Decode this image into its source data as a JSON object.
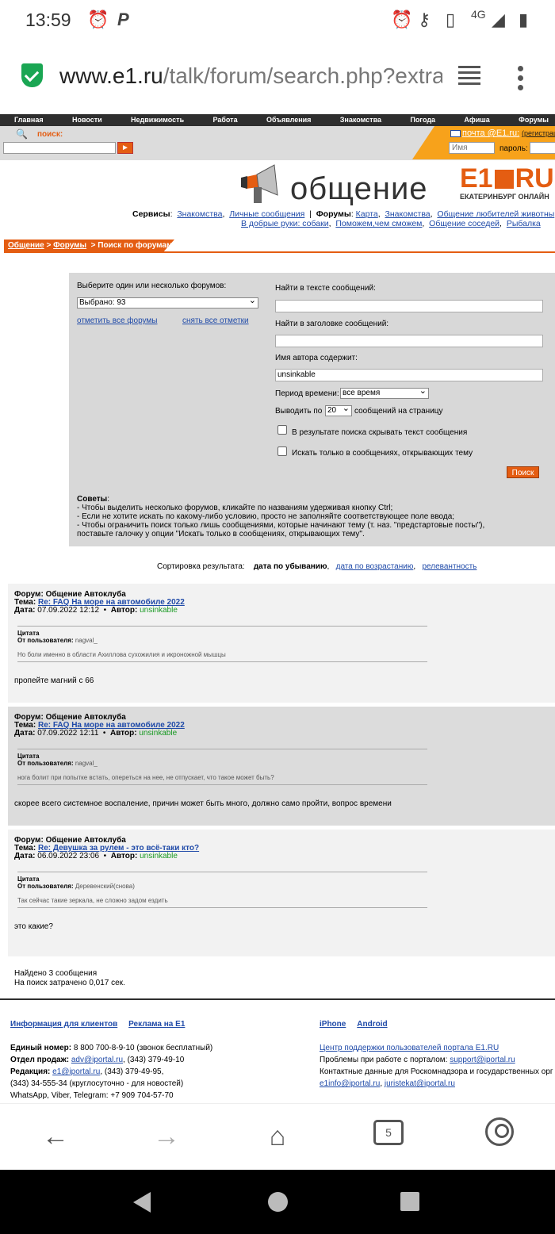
{
  "status": {
    "time": "13:59",
    "icons": [
      "alarm-icon",
      "p-icon"
    ],
    "right_icons": [
      "alarm-icon",
      "key-icon",
      "vibrate-icon",
      "4g-icon",
      "signal-icon",
      "battery-icon"
    ],
    "network": "4G"
  },
  "browser": {
    "url_host": "www.e1.ru",
    "url_path": "/talk/forum/search.php?extra",
    "tabs_count": "5"
  },
  "topnav": [
    "Главная",
    "Новости",
    "Недвижимость",
    "Работа",
    "Объявления",
    "Знакомства",
    "Погода",
    "Афиша",
    "Форумы"
  ],
  "search": {
    "label": "поиск:",
    "go": "►"
  },
  "mail": {
    "link": "почта @E1.ru:",
    "register": "(регистрац",
    "name_placeholder": "Имя",
    "password_label": "пароль:"
  },
  "logo": {
    "word": "общение",
    "brand": "E1",
    "brand_suffix": "RU",
    "city": "ЕКАТЕРИНБУРГ ОНЛАЙН"
  },
  "services": {
    "label": "Сервисы",
    "items": [
      "Знакомства",
      "Личные сообщения"
    ],
    "forums_label": "Форумы",
    "forums": [
      "Карта",
      "Знакомства",
      "Общение любителей животны"
    ],
    "forums2": [
      "В добрые руки: собаки",
      "Поможем,чем сможем",
      "Общение соседей",
      "Рыбалка"
    ]
  },
  "breadcrumb": {
    "a": "Общение",
    "b": "Форумы",
    "current": "Поиск по форумам",
    "sep": ">"
  },
  "form": {
    "choose_label": "Выберите один или несколько форумов:",
    "selected": "Выбрано: 93",
    "mark_all": "отметить все форумы",
    "unmark_all": "снять все отметки",
    "text_label": "Найти в тексте сообщений:",
    "title_label": "Найти в заголовке сообщений:",
    "author_label": "Имя автора содержит:",
    "author_value": "unsinkable",
    "period_label": "Период времени:",
    "period_value": "все время",
    "per_page_pre": "Выводить по",
    "per_page_value": "20",
    "per_page_post": "сообщений на страницу",
    "hide_text": "В результате поиска скрывать текст сообщения",
    "only_first": "Искать только в сообщениях, открывающих тему",
    "submit": "Поиск"
  },
  "tips": {
    "title": "Советы",
    "lines": [
      "- Чтобы выделить несколько форумов, кликайте по названиям удерживая кнопку Ctrl;",
      "- Если не хотите искать по какому-либо условию, просто не заполняйте соответствующее поле ввода;",
      "- Чтобы ограничить поиск только лишь сообщениями, которые начинают тему (т. наз. \"предстартовые посты\"),",
      "поставьте галочку у опции \"Искать только в сообщениях, открывающих тему\"."
    ]
  },
  "sort": {
    "label": "Сортировка результата:",
    "current": "дата по убыванию",
    "asc": "дата по возрастанию",
    "relevance": "релевантность"
  },
  "labels": {
    "forum": "Форум",
    "topic": "Тема",
    "date": "Дата",
    "author": "Автор",
    "quote": "Цитата",
    "from_user": "От пользователя"
  },
  "results": [
    {
      "forum": "Общение Автоклуба",
      "topic": "Re: FAQ На море на автомобиле 2022",
      "date": "07.09.2022 12:12",
      "author": "unsinkable",
      "quote_user": "nagval_",
      "quote_text": "Но боли именно в области Ахиллова сухожилия и икроножной мышцы",
      "body": "пропейте магний с 66"
    },
    {
      "forum": "Общение Автоклуба",
      "topic": "Re: FAQ На море на автомобиле 2022",
      "date": "07.09.2022 12:11",
      "author": "unsinkable",
      "quote_user": "nagval_",
      "quote_text": "нога болит при попытке встать, опереться на нее, не отпускает, что такое может быть?",
      "body": "скорее всего системное воспаление, причин может быть много, должно само пройти, вопрос времени"
    },
    {
      "forum": "Общение Автоклуба",
      "topic": "Re: Девушка за рулем - это всё-таки кто?",
      "date": "06.09.2022 23:06",
      "author": "unsinkable",
      "quote_user": "Деревенский(снова)",
      "quote_text": "Так сейчас такие зеркала, не сложно задом ездить",
      "body": "это какие?"
    }
  ],
  "summary": {
    "found": "Найдено 3 сообщения",
    "time": "На поиск затрачено 0,017 сек."
  },
  "footer": {
    "clients": "Информация для клиентов",
    "ads": "Реклама на E1",
    "iphone": "iPhone",
    "android": "Android",
    "phone_label": "Единый номер:",
    "phone": "8 800 700-8-9-10 (звонок бесплатный)",
    "sales_label": "Отдел продаж:",
    "sales_email": "adv@iportal.ru",
    "sales_phone": ", (343) 379-49-10",
    "editorial_label": "Редакция:",
    "editorial_email": "e1@iportal.ru",
    "editorial_phone": ", (343) 379-49-95,",
    "news_line": "(343) 34-555-34 (круглосуточно - для новостей)",
    "messengers": "WhatsApp, Viber, Telegram: +7 909 704-57-70",
    "support": "Центр поддержки пользователей портала E1.RU",
    "problems": "Проблемы при работе с порталом:",
    "support_email": "support@iportal.ru",
    "rkn": "Контактные данные для Роскомнадзора и государственных орг",
    "info_email": "e1info@iportal.ru",
    "legal_email": "juristekat@iportal.ru"
  }
}
